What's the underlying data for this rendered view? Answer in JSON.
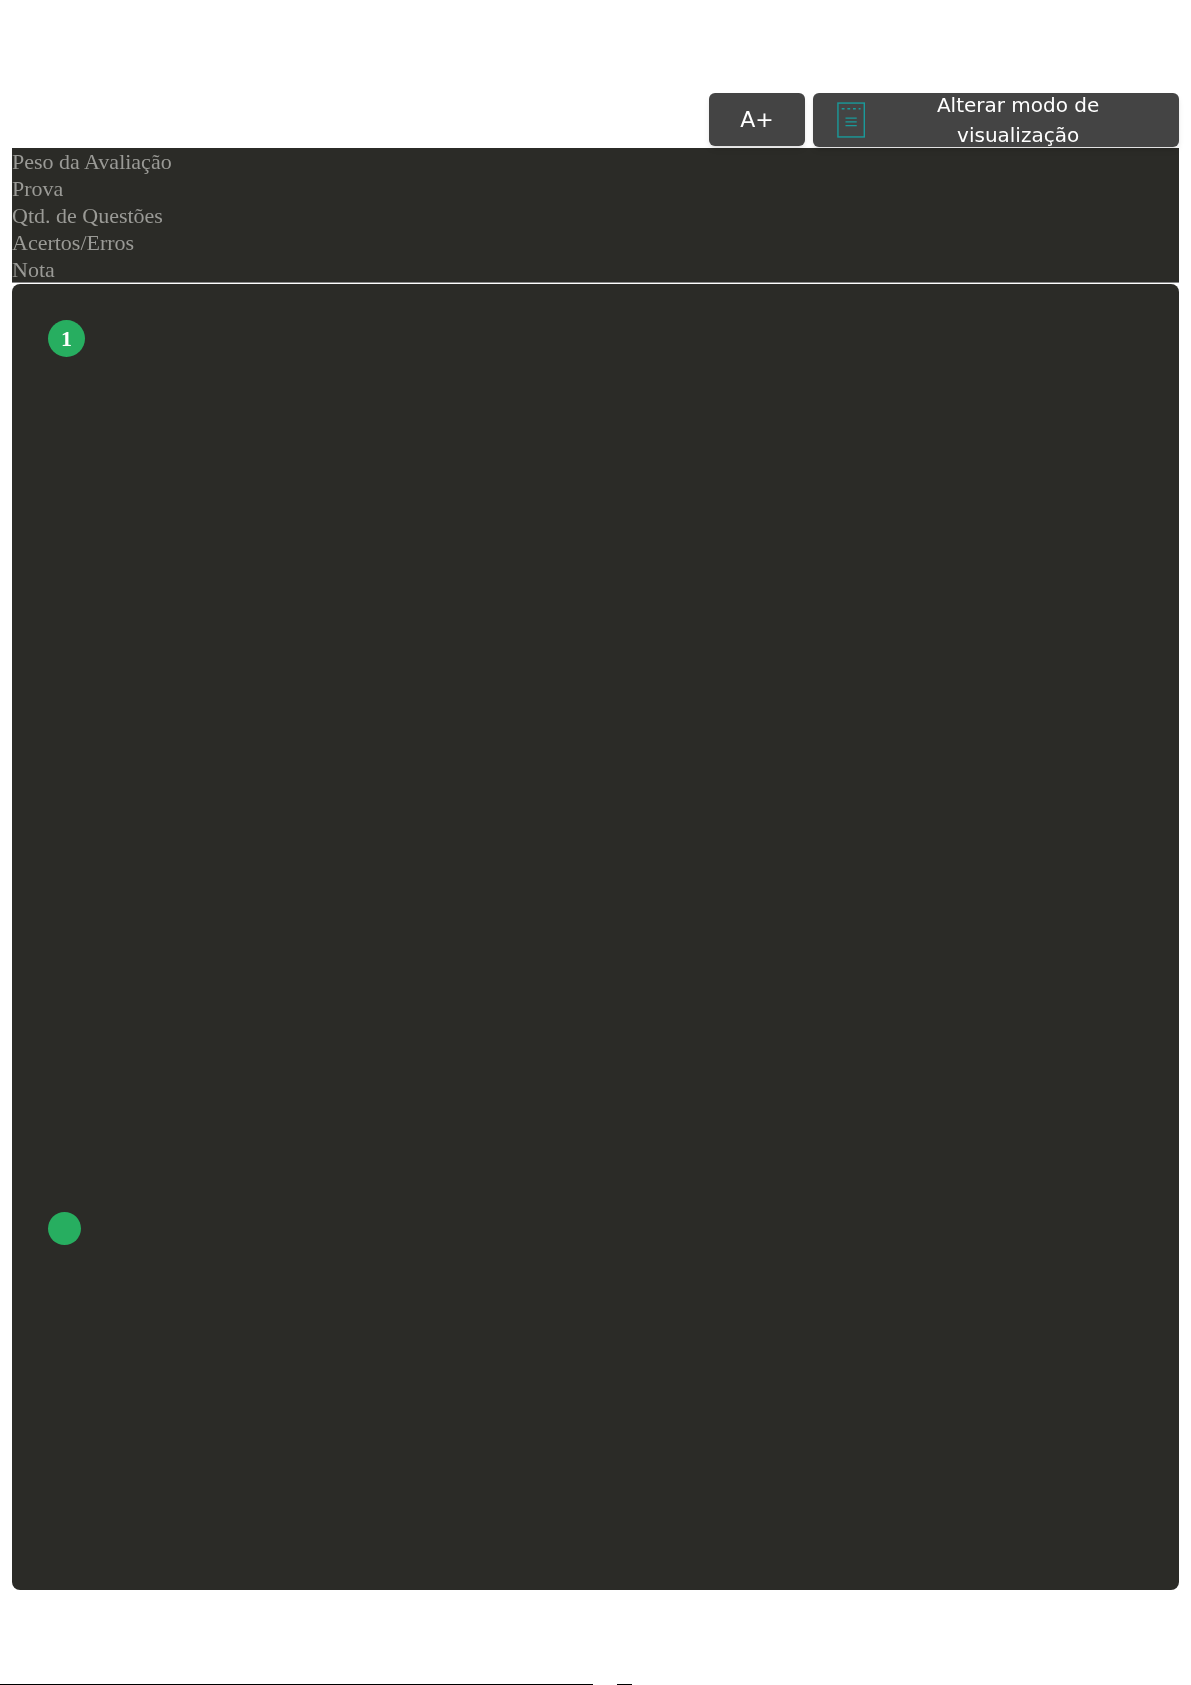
{
  "toolbar": {
    "font_button": "A+",
    "view_button": "Alterar modo de visualização"
  },
  "header_labels": [
    "Peso da Avaliação",
    "Prova",
    "Qtd. de Questões",
    "Acertos/Erros",
    "Nota"
  ],
  "questions": [
    {
      "kind": "numbered",
      "number": "1"
    },
    {
      "kind": "dot"
    }
  ]
}
